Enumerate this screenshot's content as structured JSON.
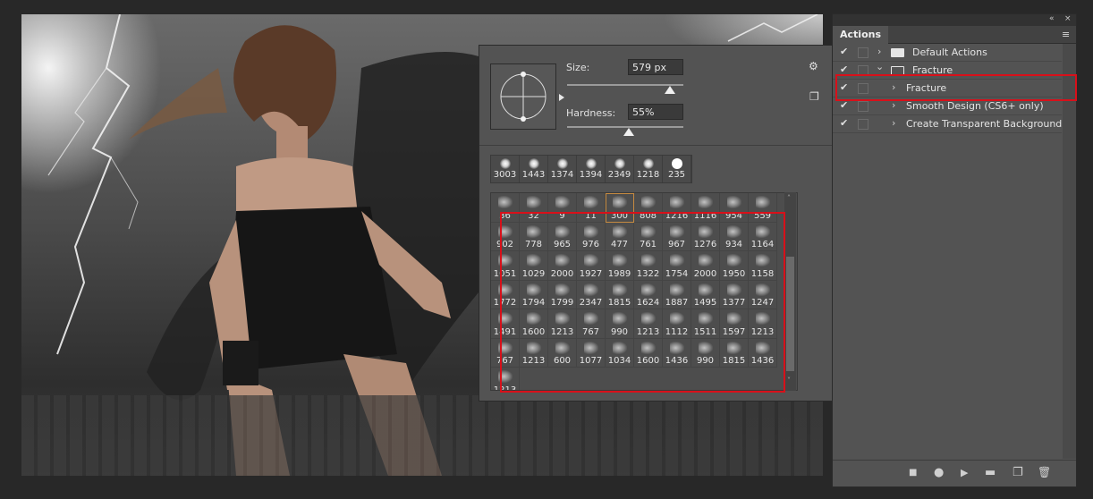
{
  "actions_panel": {
    "tab_label": "Actions",
    "collapse_icon": "«",
    "close_icon": "×",
    "menu_icon": "≡",
    "rows": [
      {
        "label": "Default Actions",
        "checked": true
      },
      {
        "label": "Fracture",
        "checked": true
      },
      {
        "label": "Fracture",
        "checked": true
      },
      {
        "label": "Smooth Design (CS6+ only)",
        "checked": true
      },
      {
        "label": "Create Transparent Background",
        "checked": true
      }
    ],
    "check_glyph": "✔",
    "caret_right": "›",
    "caret_down": "⌄",
    "bottom": {
      "stop": "■",
      "record": "●",
      "play": "▶",
      "new_set": "▬",
      "new_action": "❐",
      "delete": "🗑"
    }
  },
  "brush_picker": {
    "size_label": "Size:",
    "size_value": "579 px",
    "hardness_label": "Hardness:",
    "hardness_value": "55%",
    "size_level": 0.88,
    "hardness_level": 0.55,
    "gear_icon": "⚙",
    "new_preset_icon": "❐",
    "recent_brushes": [
      "3003",
      "1443",
      "1374",
      "1394",
      "2349",
      "1218",
      "235"
    ],
    "brushes": [
      "36",
      "32",
      "9",
      "11",
      "300",
      "808",
      "1216",
      "1116",
      "954",
      "559",
      "902",
      "778",
      "965",
      "976",
      "477",
      "761",
      "967",
      "1276",
      "934",
      "1164",
      "1051",
      "1029",
      "2000",
      "1927",
      "1989",
      "1322",
      "1754",
      "2000",
      "1950",
      "1158",
      "1772",
      "1794",
      "1799",
      "2347",
      "1815",
      "1624",
      "1887",
      "1495",
      "1377",
      "1247",
      "1491",
      "1600",
      "1213",
      "767",
      "990",
      "1213",
      "1112",
      "1511",
      "1597",
      "1213",
      "767",
      "1213",
      "600",
      "1077",
      "1034",
      "1600",
      "1436",
      "990",
      "1815",
      "1436",
      "1213"
    ],
    "selected_brush_index": 4,
    "scroll_up": "˄",
    "scroll_down": "˅"
  }
}
